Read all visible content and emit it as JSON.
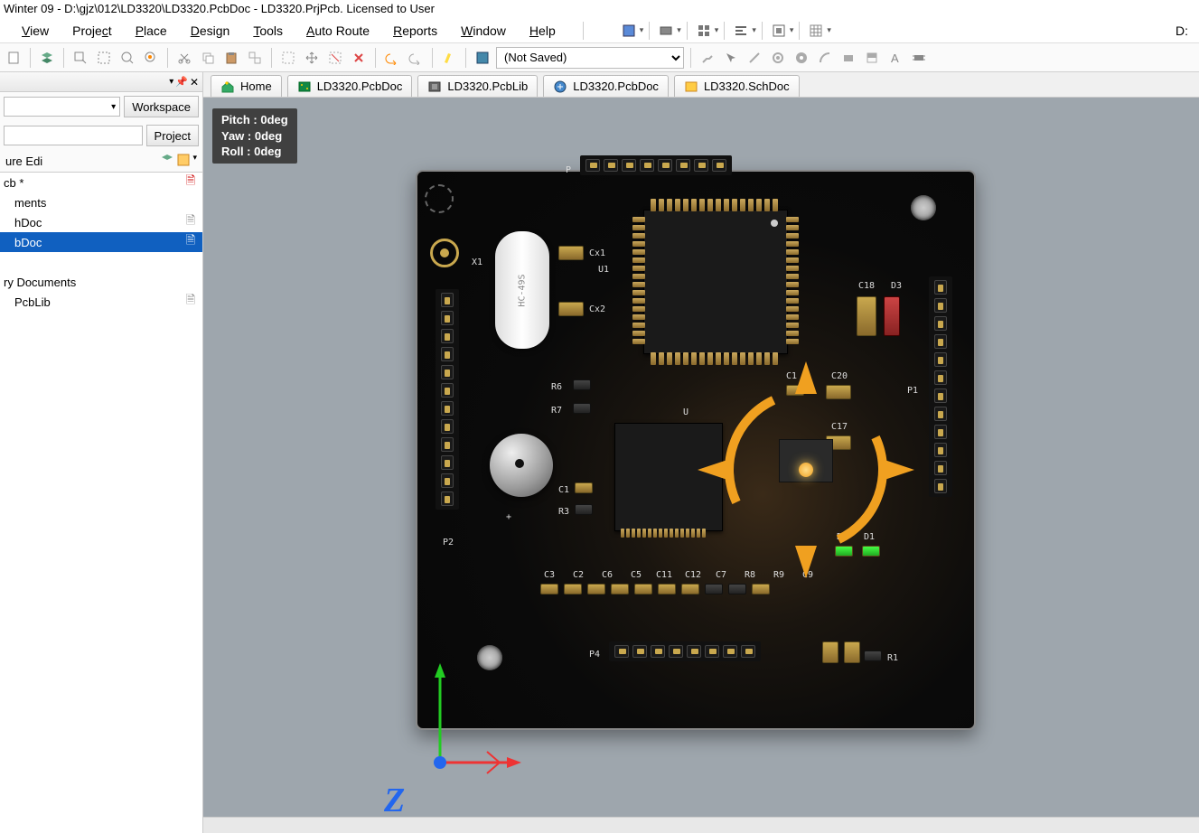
{
  "title": "Winter 09 - D:\\gjz\\012\\LD3320\\LD3320.PcbDoc - LD3320.PrjPcb. Licensed to User",
  "menu": {
    "view": "View",
    "project": "Project",
    "place": "Place",
    "design": "Design",
    "tools": "Tools",
    "autoroute": "Auto Route",
    "reports": "Reports",
    "window": "Window",
    "help": "Help"
  },
  "underline": {
    "view": "V",
    "project": "c",
    "place": "P",
    "design": "D",
    "tools": "T",
    "autoroute": "A",
    "reports": "R",
    "window": "W",
    "help": "H"
  },
  "right_label": "D:",
  "toolbar": {
    "save_state": "(Not Saved)"
  },
  "panel": {
    "workspace_btn": "Workspace",
    "project_btn": "Project",
    "strip": "ure Edi"
  },
  "tree": [
    {
      "label": "cb *",
      "icon": "📄",
      "ricolor": "#c00"
    },
    {
      "label": "ments",
      "indent": 1
    },
    {
      "label": "hDoc",
      "indent": 1,
      "ricon": "🗎"
    },
    {
      "label": "bDoc",
      "indent": 1,
      "ricon": "🗎",
      "sel": true
    },
    {
      "label": "",
      "indent": 0
    },
    {
      "label": "ry Documents",
      "indent": 0
    },
    {
      "label": "PcbLib",
      "indent": 1,
      "ricon": "🗎"
    }
  ],
  "tabs": [
    {
      "label": "Home",
      "icon": "home"
    },
    {
      "label": "LD3320.PcbDoc",
      "icon": "pcb"
    },
    {
      "label": "LD3320.PcbLib",
      "icon": "lib"
    },
    {
      "label": "LD3320.PcbDoc",
      "icon": "pcb2"
    },
    {
      "label": "LD3320.SchDoc",
      "icon": "sch"
    }
  ],
  "hud": {
    "pitch": "Pitch : 0deg",
    "yaw": "Yaw : 0deg",
    "roll": "Roll : 0deg"
  },
  "designators": {
    "P": "P",
    "X1": "X1",
    "Cx1": "Cx1",
    "U1": "U1",
    "Cx2": "Cx2",
    "C18": "C18",
    "D3": "D3",
    "R6": "R6",
    "R7": "R7",
    "C1": "C1",
    "C20": "C20",
    "U": "U",
    "P1": "P1",
    "C17": "C17",
    "C1b": "C1",
    "R3": "R3",
    "P2": "P2",
    "D2": "D2",
    "D1": "D1",
    "C3": "C3",
    "C2": "C2",
    "C6": "C6",
    "C5": "C5",
    "C11": "C11",
    "C12": "C12",
    "C7": "C7",
    "R8": "R8",
    "R9": "R9",
    "C9": "C9",
    "P4": "P4",
    "R1": "R1",
    "HC": "HC-49S",
    "Z": "Z",
    "plus": "+"
  }
}
